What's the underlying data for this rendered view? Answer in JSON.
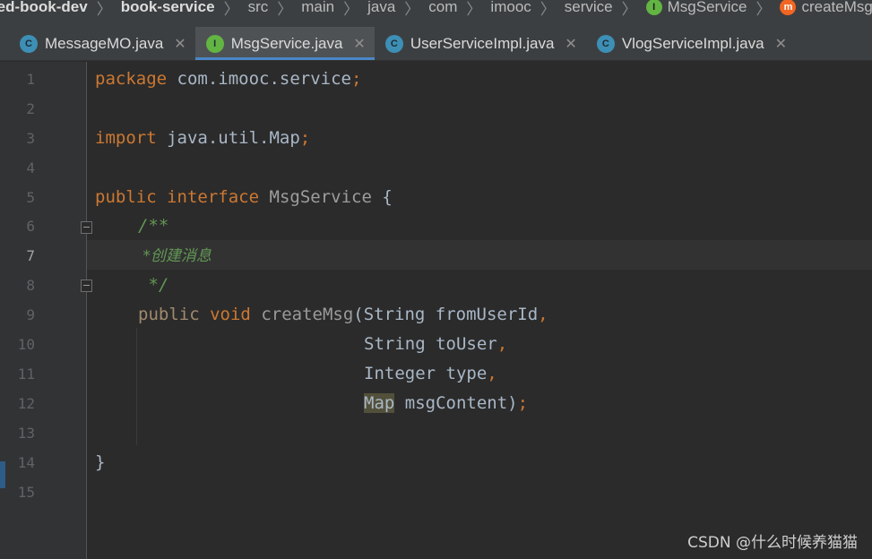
{
  "breadcrumb": {
    "items": [
      "red-book-dev",
      "book-service",
      "src",
      "main",
      "java",
      "com",
      "imooc",
      "service",
      "MsgService",
      "createMsg"
    ],
    "icons": {
      "MsgService": "interface-icon",
      "createMsg": "method-icon"
    }
  },
  "tabs": [
    {
      "label": "MessageMO.java",
      "icon": "class-icon",
      "active": false
    },
    {
      "label": "MsgService.java",
      "icon": "interface-icon",
      "active": true
    },
    {
      "label": "UserServiceImpl.java",
      "icon": "class-icon",
      "active": false
    },
    {
      "label": "VlogServiceImpl.java",
      "icon": "class-icon",
      "active": false
    }
  ],
  "tab_icon_letters": {
    "class": "C",
    "interface": "I",
    "method": "m"
  },
  "editor": {
    "current_line": 7,
    "line_numbers": [
      "1",
      "2",
      "3",
      "4",
      "5",
      "6",
      "7",
      "8",
      "9",
      "10",
      "11",
      "12",
      "13",
      "14",
      "15"
    ],
    "code": {
      "l1_kw": "package",
      "l1_rest": " com.imooc.service;",
      "l3_kw": "import",
      "l3_rest": " java.util.Map;",
      "l5_kw1": "public",
      "l5_kw2": "interface",
      "l5_name": "MsgService",
      "l5_brace": " {",
      "l6": "/**",
      "l7": " *创建消息",
      "l8": " */",
      "l9_kw1": "public",
      "l9_kw2": "void",
      "l9_meth": "createMsg",
      "l9_rest": "(String fromUserId,",
      "l10": "String toUser,",
      "l11": "Integer type,",
      "l12_type": "Map",
      "l12_rest": " msgContent);",
      "l14": "}"
    }
  },
  "colors": {
    "keyword": "#cc7832",
    "comment": "#629755",
    "default_text": "#a9b7c6",
    "tab_underline": "#4a88c7",
    "class_icon": "#3d8fb5",
    "interface_icon": "#62b543"
  },
  "watermark": "CSDN @什么时候养猫猫"
}
